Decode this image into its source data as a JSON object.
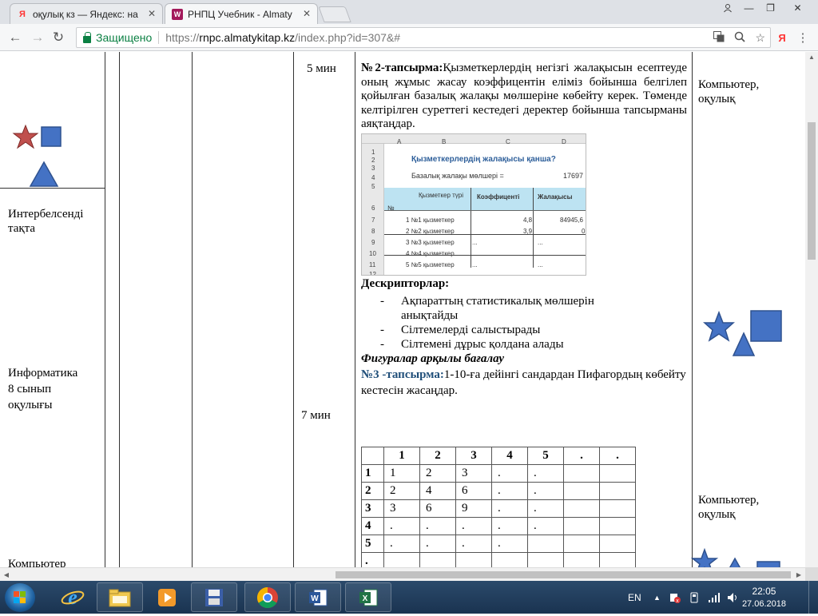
{
  "browser": {
    "tabs": [
      {
        "label": "оқулық кз — Яндекс: на",
        "favicon": "Я",
        "active": false
      },
      {
        "label": "РНПЦ Учебник - Almaty",
        "favicon": "W",
        "active": true
      }
    ],
    "url": {
      "secure_label": "Защищено",
      "scheme": "https://",
      "host": "rnpc.almatykitap.kz",
      "path": "/index.php?id=307&#"
    }
  },
  "doc": {
    "col1": {
      "interactive_board": "Интербелсенді тақта",
      "textbook_line1": "Информатика",
      "textbook_line2": "8 сынып",
      "textbook_line3": "оқулығы",
      "computer": "Компьютер"
    },
    "col4": {
      "time1": "5 мин",
      "time2": "7 мин"
    },
    "task2": {
      "label": "№2-тапсырма:",
      "text": "Қызметкерлердің негізгі жалақысын есептеуде оның жұмыс жасау коэффицентін еліміз бойынша белгілеп қойылған базалық жалақы мөлшеріне көбейту керек. Төменде келтірілген суреттегі кестедегі деректер бойынша тапсырманы аяқтаңдар."
    },
    "spreadsheet": {
      "col_headers": [
        "A",
        "B",
        "C",
        "D"
      ],
      "row_numbers": [
        "1",
        "2",
        "3",
        "4",
        "5",
        "6",
        "7",
        "8",
        "9",
        "10",
        "11",
        "12"
      ],
      "title": "Қызметкерлердің жалақысы қанша?",
      "base_label": "Базалық жалақы мөлшері =",
      "base_value": "17697",
      "header_no": "№",
      "header_type": "Қызметкер түрі",
      "header_coef": "Коэффиценті",
      "header_salary": "Жалақысы",
      "rows": [
        {
          "type": "1 №1 қызметкер",
          "coef": "4,8",
          "salary": "84945,6"
        },
        {
          "type": "2 №2 қызметкер",
          "coef": "3,9",
          "salary": "0"
        },
        {
          "type": "3 №3 қызметкер",
          "coef": "...",
          "salary": "..."
        },
        {
          "type": "4 №4 қызметкер",
          "coef": "...",
          "salary": "..."
        },
        {
          "type": "5 №5 қызметкер",
          "coef": "...",
          "salary": "..."
        }
      ]
    },
    "descriptors": {
      "title": "Дескрипторлар:",
      "items": [
        "Ақпараттың статистикалық мөлшерін анықтайды",
        "Сілтемелерді салыстырады",
        "Сілтемені дұрыс қолдана алады"
      ]
    },
    "assessment": "Фигуралар арқылы бағалау",
    "task3": {
      "label": "№3 -тапсырма:",
      "text": "1-10-ға дейінгі сандардан Пифагордың көбейту кестесін жасаңдар."
    },
    "pythagoras": {
      "header": [
        "",
        "1",
        "2",
        "3",
        "4",
        "5",
        ".",
        "."
      ],
      "rows": [
        [
          "1",
          "1",
          "2",
          "3",
          ".",
          ".",
          "",
          ""
        ],
        [
          "2",
          "2",
          "4",
          "6",
          ".",
          ".",
          "",
          ""
        ],
        [
          "3",
          "3",
          "6",
          "9",
          ".",
          ".",
          "",
          ""
        ],
        [
          "4",
          ".",
          ".",
          ".",
          ".",
          ".",
          "",
          ""
        ],
        [
          "5",
          ".",
          ".",
          ".",
          ".",
          "",
          "",
          ""
        ],
        [
          ".",
          "",
          "",
          "",
          "",
          "",
          "",
          ""
        ],
        [
          "",
          "",
          "",
          "",
          "",
          "",
          "",
          ""
        ]
      ]
    },
    "resources1": "Компьютер, оқулық",
    "resources2": "Компьютер, оқулық"
  },
  "taskbar": {
    "lang": "EN",
    "time": "22:05",
    "date": "27.06.2018"
  },
  "colors": {
    "shape_fill": "#4472c4",
    "shape_stroke": "#2f528f",
    "star_red": "#c0504d",
    "secure_green": "#0b8043",
    "task_label_blue": "#1f4e79"
  }
}
